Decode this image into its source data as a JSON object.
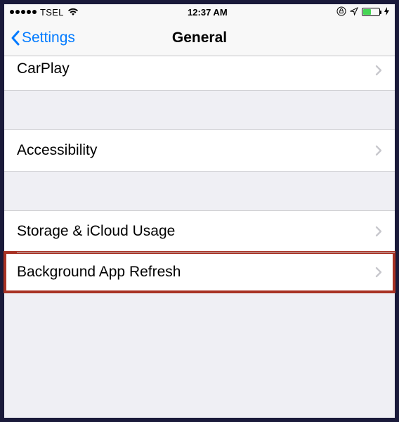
{
  "status_bar": {
    "carrier": "TSEL",
    "time": "12:37 AM"
  },
  "nav": {
    "back_label": "Settings",
    "title": "General"
  },
  "rows": {
    "carplay": "CarPlay",
    "accessibility": "Accessibility",
    "storage": "Storage & iCloud Usage",
    "background_refresh": "Background App Refresh"
  }
}
